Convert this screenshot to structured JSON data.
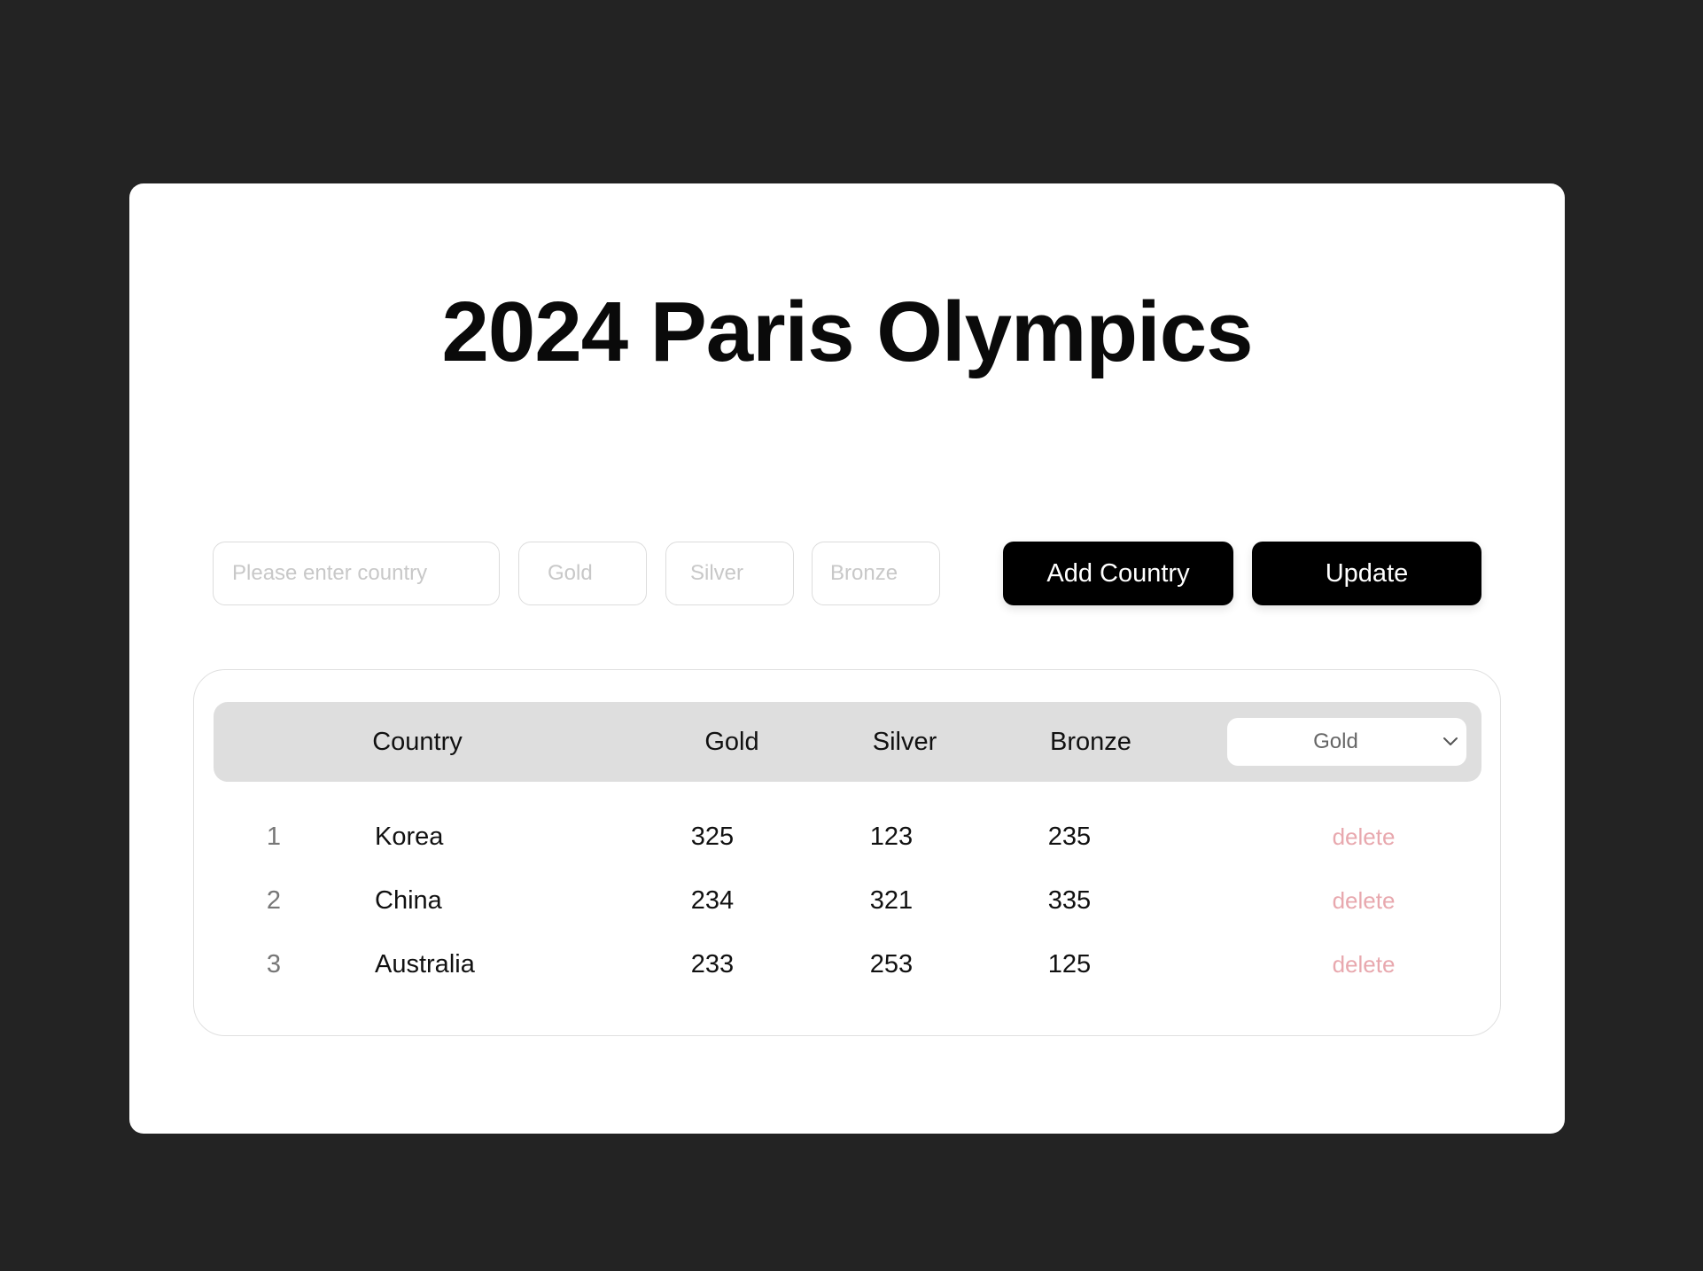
{
  "page": {
    "title": "2024 Paris Olympics"
  },
  "form": {
    "country_placeholder": "Please enter country",
    "country_value": "",
    "gold_placeholder": "Gold",
    "gold_value": "",
    "silver_placeholder": "Silver",
    "silver_value": "",
    "bronze_placeholder": "Bronze",
    "bronze_value": "",
    "add_label": "Add Country",
    "update_label": "Update"
  },
  "table": {
    "headers": {
      "country": "Country",
      "gold": "Gold",
      "silver": "Silver",
      "bronze": "Bronze"
    },
    "sort": {
      "selected": "Gold",
      "icon": "chevron-down-icon"
    },
    "delete_label": "delete",
    "rows": [
      {
        "rank": "1",
        "country": "Korea",
        "gold": "325",
        "silver": "123",
        "bronze": "235",
        "action": "delete"
      },
      {
        "rank": "2",
        "country": "China",
        "gold": "234",
        "silver": "321",
        "bronze": "335",
        "action": "delete"
      },
      {
        "rank": "3",
        "country": "Australia",
        "gold": "233",
        "silver": "253",
        "bronze": "125",
        "action": "delete"
      }
    ]
  },
  "colors": {
    "background": "#232323",
    "card": "#ffffff",
    "button": "#000000",
    "header_bg": "#dedede",
    "delete_text": "#e8a8ae"
  }
}
